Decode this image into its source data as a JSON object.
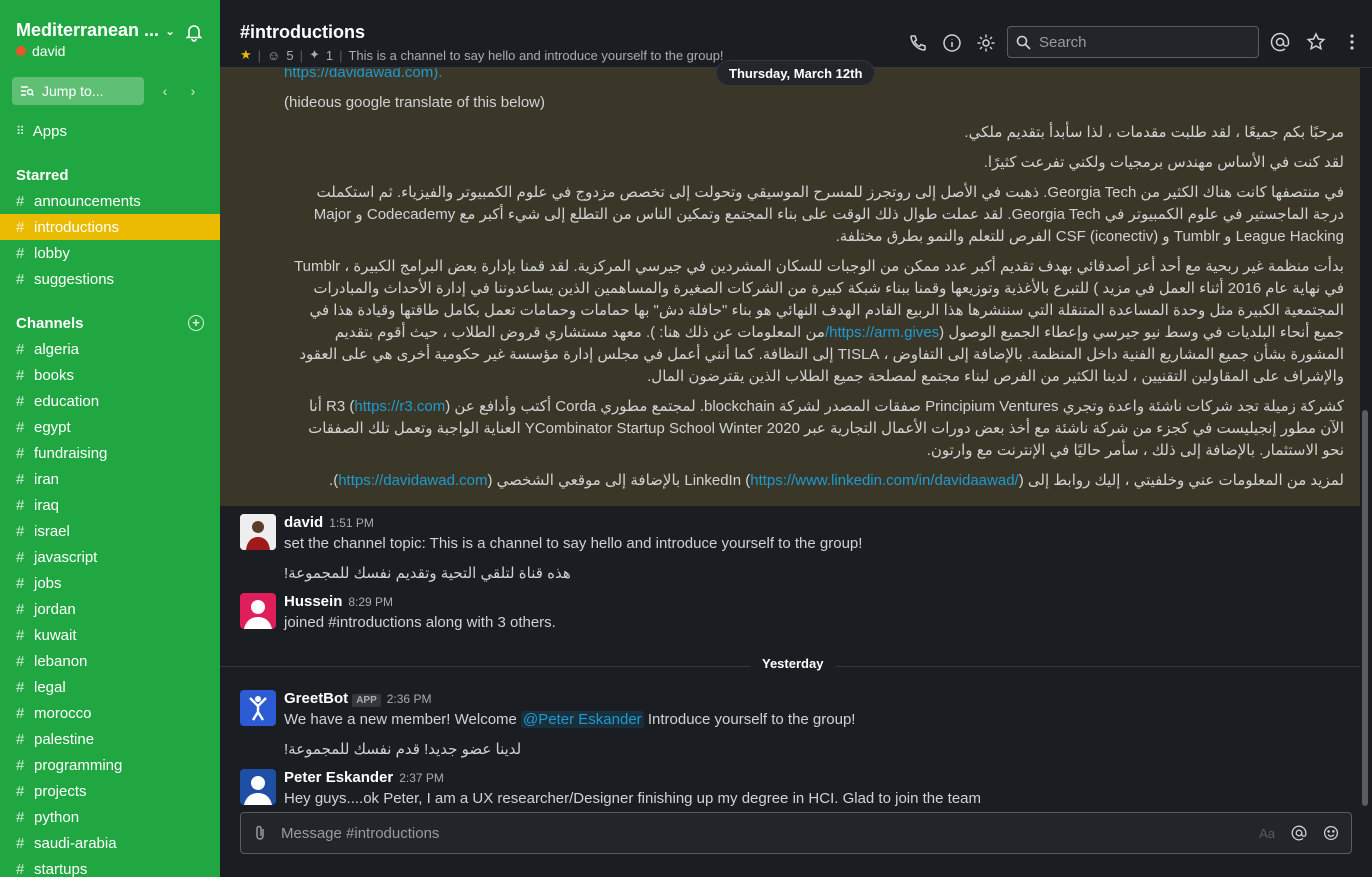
{
  "workspace": {
    "name": "Mediterranean ...",
    "user": "david",
    "jump_label": "Jump to..."
  },
  "sidebar": {
    "apps_label": "Apps",
    "starred_title": "Starred",
    "starred": [
      "announcements",
      "introductions",
      "lobby",
      "suggestions"
    ],
    "active": "introductions",
    "channels_title": "Channels",
    "channels": [
      "algeria",
      "books",
      "education",
      "egypt",
      "fundraising",
      "iran",
      "iraq",
      "israel",
      "javascript",
      "jobs",
      "jordan",
      "kuwait",
      "lebanon",
      "legal",
      "morocco",
      "palestine",
      "programming",
      "projects",
      "python",
      "saudi-arabia",
      "startups"
    ]
  },
  "header": {
    "title": "#introductions",
    "members": "5",
    "pins": "1",
    "topic": "This is a channel to say hello and introduce yourself to the group!",
    "search_placeholder": "Search"
  },
  "date_pill": "Thursday, March 12th",
  "highlight": {
    "link_top": "https://davidawad.com).",
    "translate_note": "(hideous google translate of this below)",
    "p1": "مرحبًا بكم جميعًا ، لقد طلبت مقدمات ، لذا سأبدأ بتقديم ملكي.",
    "p2": "لقد كنت في الأساس مهندس برمجيات ولكني تفرعت كثيرًا.",
    "p3": "في منتصفها كانت هناك الكثير من Georgia Tech. ذهبت في الأصل إلى روتجرز للمسرح الموسيقي وتحولت إلى تخصص مزدوج في علوم الكمبيوتر والفيزياء. ثم استكملت درجة الماجستير في علوم الكمبيوتر في Georgia Tech. لقد عملت طوال ذلك الوقت على بناء المجتمع وتمكين الناس من التطلع إلى شيء أكبر مع Codecademy و Major League Hacking و Tumblr و CSF (iconectiv) الفرص للتعلم والنمو بطرق مختلفة.",
    "p4a": "بدأت منظمة غير ربحية مع أحد أعز أصدقائي بهدف تقديم أكبر عدد ممكن من الوجبات للسكان المشردين في جيرسي المركزية. لقد قمنا بإدارة بعض البرامج الكبيرة ، Tumblr في نهاية عام 2016 أثناء العمل في مزيد ) للتبرع بالأغذية وتوزيعها وقمنا ببناء شبكة كبيرة من الشركات الصغيرة والمساهمين الذين يساعدوننا في إدارة الأحداث والمبادرات المجتمعية الكبيرة مثل وحدة المساعدة المتنقلة التي سننشرها هذا الربيع القادم الهدف النهائي هو بناء \"حافلة دش\" بها حمامات وحمامات تعمل بكامل طاقتها وقيادة هذا في جميع أنحاء البلديات في وسط نيو جيرسي وإعطاء الجميع الوصول (",
    "p4_link": "https://arm.gives/",
    "p4b": "من المعلومات عن ذلك هنا: ). معهد مستشاري قروض الطلاب ، حيث أقوم بتقديم المشورة بشأن جميع المشاريع الفنية داخل المنظمة. بالإضافة إلى التفاوض ، TISLA إلى النظافة. كما أنني أعمل في مجلس إدارة مؤسسة غير حكومية أخرى هي على العقود والإشراف على المقاولين التقنيين ، لدينا الكثير من الفرص لبناء مجتمع لمصلحة جميع الطلاب الذين يقترضون المال.",
    "p5a": "كشركة زميلة تجد شركات ناشئة واعدة وتجري Principium Ventures صفقات المصدر لشركة blockchain. لمجتمع مطوري Corda أكتب وأدافع عن R3 (",
    "p5_link": "https://r3.com",
    "p5b": ") أنا الآن مطور إنجيليست في كجزء من شركة ناشئة مع أخذ بعض دورات الأعمال التجارية عبر YCombinator Startup School Winter 2020 العناية الواجبة وتعمل تلك الصفقات نحو الاستثمار. بالإضافة إلى ذلك ، سأمر حاليًا في الإنترنت مع وارتون.",
    "p6a": "لمزيد من المعلومات عني وخلفيتي ، إليك روابط إلى LinkedIn (",
    "p6_link1": "https://www.linkedin.com/in/davidaawad/",
    "p6b": ") بالإضافة إلى موقعي الشخصي (",
    "p6_link2": "https://davidawad.com",
    "p6c": ")."
  },
  "messages": [
    {
      "author": "david",
      "time": "1:51 PM",
      "text": "set the channel topic: This is a channel to say hello and introduce yourself to the group!",
      "cont": "هذه قناة لتلقي التحية وتقديم نفسك للمجموعة!"
    },
    {
      "author": "Hussein",
      "time": "8:29 PM",
      "text": "joined #introductions along with 3 others."
    }
  ],
  "divider_label": "Yesterday",
  "greetbot": {
    "author": "GreetBot",
    "badge": "APP",
    "time": "2:36 PM",
    "pre": "We have a new member! Welcome ",
    "mention": "@Peter Eskander",
    "post": " Introduce yourself to the group!",
    "cont": "لدينا عضو جديد! قدم نفسك للمجموعة!"
  },
  "peter": {
    "author": "Peter Eskander",
    "time": "2:37 PM",
    "text": "Hey guys....ok Peter, I am a UX researcher/Designer finishing up my degree in HCI. Glad to join the team"
  },
  "composer": {
    "placeholder": "Message #introductions",
    "format_label": "Aa"
  },
  "colors": {
    "sidebar": "#20a741",
    "active": "#eabb00",
    "link": "#1d9bd1",
    "highlight": "#3b3728"
  }
}
